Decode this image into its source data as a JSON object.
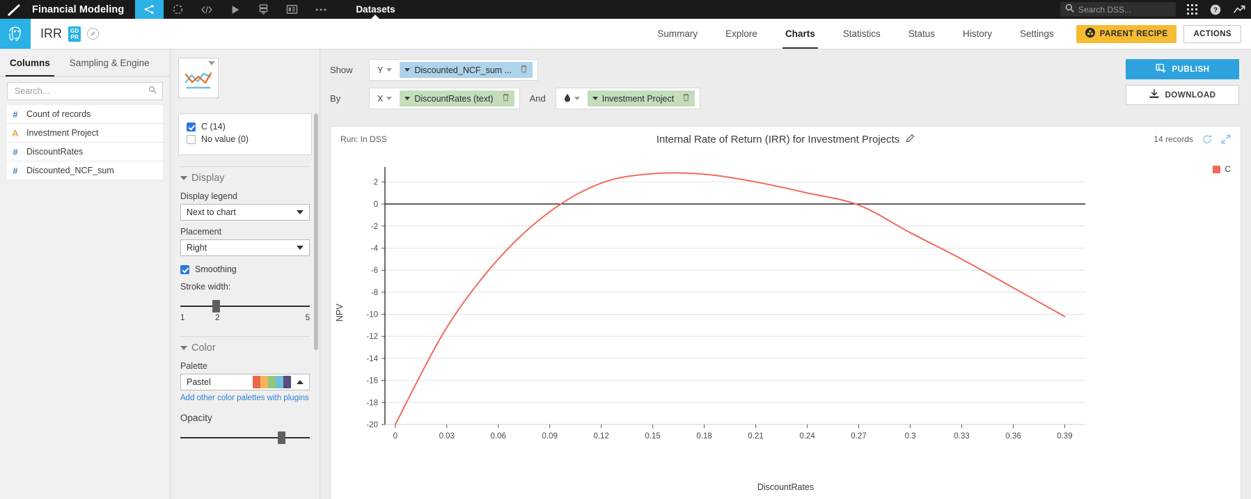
{
  "topbar": {
    "logo_icon": "dataiku-logo-icon",
    "project_name": "Financial Modeling",
    "icons": [
      {
        "name": "flow-icon",
        "glyph": "flow",
        "active": true
      },
      {
        "name": "recipes-icon",
        "glyph": "dashed-circle",
        "active": false
      },
      {
        "name": "code-icon",
        "glyph": "code",
        "active": false
      },
      {
        "name": "scenarios-icon",
        "glyph": "play",
        "active": false
      },
      {
        "name": "jobs-icon",
        "glyph": "jobs",
        "active": false
      },
      {
        "name": "dashboards-icon",
        "glyph": "dashboard",
        "active": false
      },
      {
        "name": "more-icon",
        "glyph": "ellipsis",
        "active": false
      }
    ],
    "section_label": "Datasets",
    "search_placeholder": "Search DSS...",
    "search_value": "",
    "right_icons": [
      {
        "name": "apps-grid-icon",
        "glyph": "grid"
      },
      {
        "name": "help-icon",
        "glyph": "question"
      },
      {
        "name": "activity-icon",
        "glyph": "trend"
      }
    ]
  },
  "subheader": {
    "db_icon": "postgresql-elephant-icon",
    "dataset_name": "IRR",
    "gdpr_line1": "GD",
    "gdpr_line2": "PR",
    "status_icon": "compass-icon",
    "nav": [
      {
        "label": "Summary",
        "active": false
      },
      {
        "label": "Explore",
        "active": false
      },
      {
        "label": "Charts",
        "active": true
      },
      {
        "label": "Statistics",
        "active": false
      },
      {
        "label": "Status",
        "active": false
      },
      {
        "label": "History",
        "active": false
      },
      {
        "label": "Settings",
        "active": false
      }
    ],
    "parent_recipe_label": "PARENT RECIPE",
    "actions_label": "ACTIONS"
  },
  "columns_panel": {
    "tabs": [
      {
        "label": "Columns",
        "active": true
      },
      {
        "label": "Sampling & Engine",
        "active": false
      }
    ],
    "search_placeholder": "Search...",
    "search_value": "",
    "columns": [
      {
        "type": "#",
        "type_class": "num",
        "label": "Count of records"
      },
      {
        "type": "A",
        "type_class": "txt",
        "label": "Investment Project"
      },
      {
        "type": "#",
        "type_class": "num",
        "label": "DiscountRates"
      },
      {
        "type": "#",
        "type_class": "num",
        "label": "Discounted_NCF_sum"
      }
    ]
  },
  "settings_panel": {
    "chart_type_icon": "lines-chart-type-icon",
    "series": [
      {
        "label": "C (14)",
        "checked": true
      },
      {
        "label": "No value (0)",
        "checked": false
      }
    ],
    "display": {
      "section_title": "Display",
      "legend_label": "Display legend",
      "legend_value": "Next to chart",
      "placement_label": "Placement",
      "placement_value": "Right",
      "smoothing_label": "Smoothing",
      "smoothing_checked": true,
      "stroke_label": "Stroke width:",
      "stroke_min": "1",
      "stroke_value": "2",
      "stroke_max": "5"
    },
    "color": {
      "section_title": "Color",
      "palette_label": "Palette",
      "palette_value": "Pastel",
      "palette_colors": [
        "#ef6548",
        "#f7b456",
        "#8fc77f",
        "#6fc0d8",
        "#5a4d80"
      ],
      "palettes_link": "Add other color palettes with plugins",
      "opacity_label": "Opacity"
    }
  },
  "chart_config": {
    "show_label": "Show",
    "by_label": "By",
    "and_label": "And",
    "y_axis_label": "Y",
    "x_axis_label": "X",
    "color_axis_icon": "droplet-icon",
    "y_measure": "Discounted_NCF_sum ...",
    "x_dimension": "DiscountRates (text)",
    "color_dimension": "Investment Project",
    "trash_icon": "trash-icon",
    "publish_label": "PUBLISH",
    "publish_icon": "publish-icon",
    "download_label": "DOWNLOAD",
    "download_icon": "download-icon"
  },
  "chart_header": {
    "run_info": "Run: In DSS",
    "title": "Internal Rate of Return (IRR) for Investment Projects",
    "edit_icon": "pencil-icon",
    "records": "14 records",
    "refresh_icon": "refresh-icon",
    "expand_icon": "expand-icon"
  },
  "chart_data": {
    "type": "line",
    "title": "Internal Rate of Return (IRR) for Investment Projects",
    "xlabel": "DiscountRates",
    "ylabel": "NPV",
    "xlim": [
      -0.006,
      0.402
    ],
    "ylim": [
      -20,
      3.1
    ],
    "xticks": [
      "0",
      "0.03",
      "0.06",
      "0.09",
      "0.12",
      "0.15",
      "0.18",
      "0.21",
      "0.24",
      "0.27",
      "0.3",
      "0.33",
      "0.36",
      "0.39"
    ],
    "xtick_values": [
      0,
      0.03,
      0.06,
      0.09,
      0.12,
      0.15,
      0.18,
      0.21,
      0.24,
      0.27,
      0.3,
      0.33,
      0.36,
      0.39
    ],
    "yticks": [
      "2",
      "0",
      "-2",
      "-4",
      "-6",
      "-8",
      "-10",
      "-12",
      "-14",
      "-16",
      "-18",
      "-20"
    ],
    "ytick_values": [
      2,
      0,
      -2,
      -4,
      -6,
      -8,
      -10,
      -12,
      -14,
      -16,
      -18,
      -20
    ],
    "grid": true,
    "smoothing": true,
    "legend_position": "right",
    "series": [
      {
        "name": "C",
        "color": "#f2695b",
        "x": [
          0,
          0.03,
          0.06,
          0.09,
          0.12,
          0.15,
          0.18,
          0.21,
          0.24,
          0.27,
          0.3,
          0.33,
          0.36,
          0.39
        ],
        "y": [
          -20.0,
          -11.2,
          -5.0,
          -0.7,
          1.9,
          2.75,
          2.7,
          2.0,
          1.0,
          -0.1,
          -2.6,
          -5.0,
          -7.6,
          -10.2
        ]
      }
    ],
    "zero_line": 0
  }
}
